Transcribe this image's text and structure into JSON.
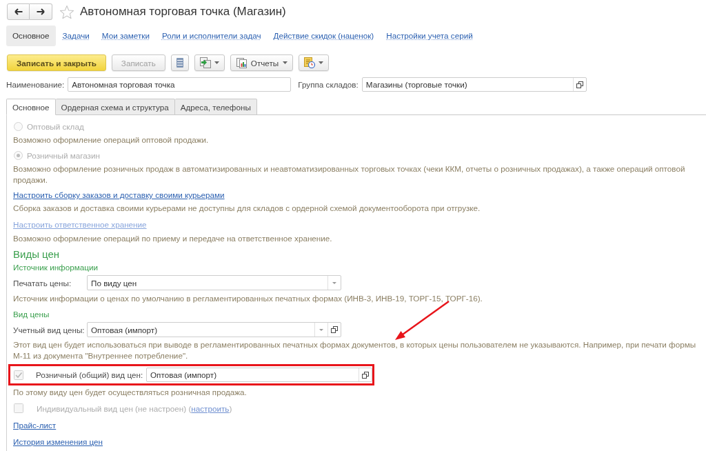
{
  "window": {
    "title": "Автономная торговая точка (Магазин)",
    "favorite": false
  },
  "sections": [
    {
      "label": "Основное",
      "selected": true
    },
    {
      "label": "Задачи",
      "selected": false
    },
    {
      "label": "Мои заметки",
      "selected": false
    },
    {
      "label": "Роли и исполнители задач",
      "selected": false
    },
    {
      "label": "Действие скидок (наценок)",
      "selected": false
    },
    {
      "label": "Настройки учета серий",
      "selected": false
    }
  ],
  "toolbar": {
    "save_and_close": {
      "label": "Записать и закрыть"
    },
    "save": {
      "label": "Записать",
      "disabled": true
    },
    "reports": {
      "label": "Отчеты"
    }
  },
  "header_fields": {
    "name": {
      "label": "Наименование:",
      "value": "Автономная торговая точка"
    },
    "group": {
      "label": "Группа складов:",
      "value": "Магазины (торговые точки)"
    }
  },
  "tabs": [
    {
      "label": "Основное",
      "selected": true
    },
    {
      "label": "Ордерная схема и структура",
      "selected": false
    },
    {
      "label": "Адреса, телефоны",
      "selected": false
    }
  ],
  "store_type": [
    {
      "label": "Оптовый склад",
      "selected": false,
      "disabled": true,
      "description": "Возможно оформление операций оптовой продажи."
    },
    {
      "label": "Розничный магазин",
      "selected": true,
      "disabled": true,
      "description": "Возможно оформление розничных продаж в автоматизированных и неавтоматизированных торговых точках (чеки ККМ, отчеты о розничных продажах), а также операций оптовой продажи."
    }
  ],
  "setup_links": [
    {
      "text": "Настроить сборку заказов и доставку своими курьерами",
      "disabled": false,
      "description": "Сборка заказов и доставка своими курьерами не доступны для складов с ордерной схемой документооборота при отгрузке."
    },
    {
      "text": "Настроить ответственное хранение",
      "disabled": true,
      "description": "Возможно оформление операций по приему и передаче на ответственное хранение."
    }
  ],
  "price_types": {
    "heading": "Виды цен",
    "info_source": {
      "heading": "Источник информации",
      "label": "Печатать цены:",
      "value": "По виду цен",
      "description": "Источник информации о ценах по умолчанию в регламентированных печатных формах (ИНВ-3, ИНВ-19, ТОРГ-15, ТОРГ-16)."
    },
    "price_type": {
      "heading": "Вид цены",
      "label": "Учетный вид цены:",
      "value": "Оптовая (импорт)",
      "description": "Этот вид цен будет использоваться при выводе в регламентированных печатных формах документов, в которых цены пользователем не указываются. Например, при печати формы М-11 из документа \"Внутреннее потребление\"."
    },
    "retail": {
      "checked": true,
      "disabled": true,
      "highlighted": true,
      "label": "Розничный (общий) вид цен:",
      "value": "Оптовая (импорт)",
      "description": "По этому виду цен будет осуществляться розничная продажа."
    },
    "individual": {
      "checked": false,
      "disabled": true,
      "label": "Индивидуальный вид цен (не настроен) (",
      "link": "настроить",
      "label_end": ")"
    }
  },
  "footer_links": [
    {
      "text": "Прайс-лист"
    },
    {
      "text": "История изменения цен"
    }
  ],
  "annotation_arrow": true
}
